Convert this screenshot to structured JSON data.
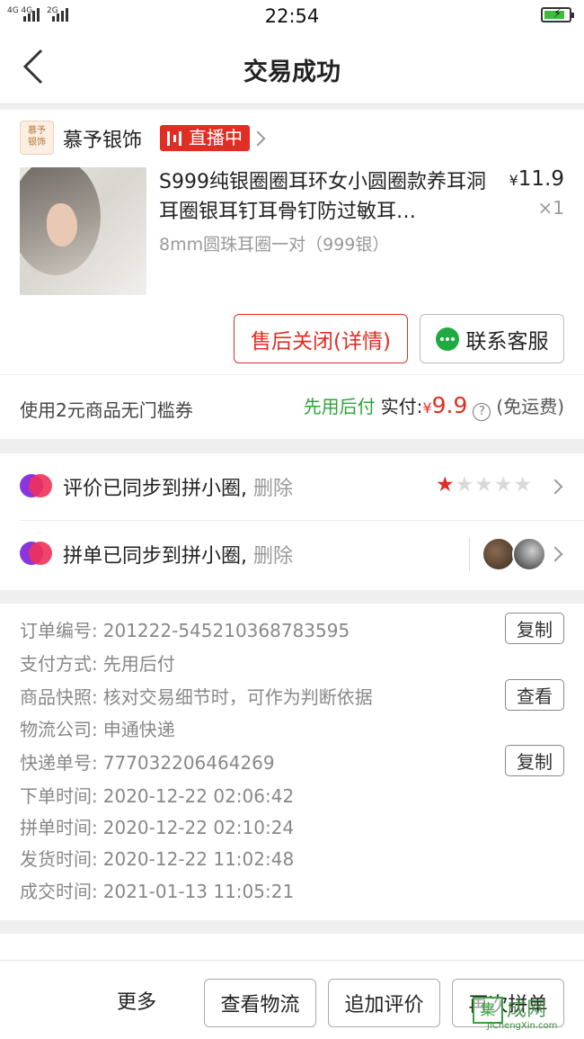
{
  "status_bar": {
    "signal_left": "4G 4G",
    "signal_right": "2G",
    "time": "22:54"
  },
  "nav": {
    "title": "交易成功"
  },
  "order_card": {
    "shop_logo_text": "慕予\n银饰",
    "shop_name": "慕予银饰",
    "live_badge": "直播中",
    "product_name": "S999纯银圈圈耳环女小圆圈款养耳洞耳圈银耳钉耳骨钉防过敏耳…",
    "product_spec": "8mm圆珠耳圈一对（999银）",
    "price_symbol": "¥",
    "price": "11.9",
    "quantity": "×1",
    "after_sale_button": "售后关闭(详情)",
    "customer_service_button": "联系客服",
    "coupon_text": "使用2元商品无门槛券",
    "pay_later": "先用后付",
    "paid_label": "实付:",
    "paid_symbol": "¥",
    "paid_amount": "9.9",
    "help_icon": "?",
    "free_shipping": "(免运费)"
  },
  "sync_card": {
    "review_text": "评价已同步到拼小圈,",
    "review_delete": "删除",
    "rating": 1,
    "rating_max": 5,
    "group_text": "拼单已同步到拼小圈,",
    "group_delete": "删除"
  },
  "info_card": {
    "rows": [
      {
        "label": "订单编号:",
        "value": "201222-545210368783595",
        "action": "复制"
      },
      {
        "label": "支付方式:",
        "value": "先用后付",
        "action": ""
      },
      {
        "label": "商品快照:",
        "value": "核对交易细节时，可作为判断依据",
        "action": "查看"
      },
      {
        "label": "物流公司:",
        "value": "申通快递",
        "action": ""
      },
      {
        "label": "快递单号:",
        "value": "777032206464269",
        "action": "复制"
      },
      {
        "label": "下单时间:",
        "value": "2020-12-22 02:06:42",
        "action": ""
      },
      {
        "label": "拼单时间:",
        "value": "2020-12-22 02:10:24",
        "action": ""
      },
      {
        "label": "发货时间:",
        "value": "2020-12-22 11:02:48",
        "action": ""
      },
      {
        "label": "成交时间:",
        "value": "2021-01-13 11:05:21",
        "action": ""
      }
    ]
  },
  "bottom_bar": {
    "more": "更多",
    "logistics_button": "查看物流",
    "add_review_button": "追加评价",
    "regroup_button": "再次拼单"
  },
  "watermark": {
    "box": "集",
    "name": "成网",
    "url": "JiChengXin.com"
  },
  "colors": {
    "accent": "#e02e24",
    "green": "#2fa33b",
    "star_on": "#e02e24",
    "star_off": "#d8d8d8"
  }
}
